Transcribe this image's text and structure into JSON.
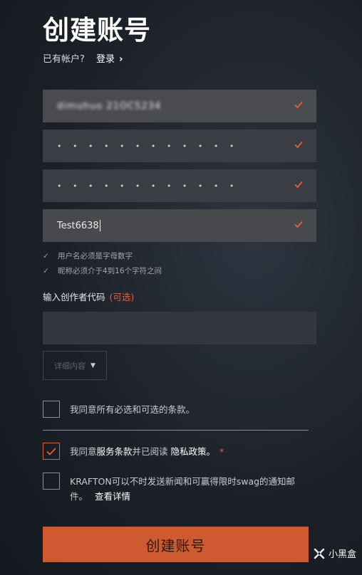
{
  "header": {
    "title": "创建账号",
    "have_account": "已有帐户?",
    "login_link": "登录",
    "login_chevron": "›"
  },
  "form": {
    "email_value": "dimuhuo 21OC5234",
    "password_dots": "• • • • • • • • • • • •",
    "confirm_dots": "• • • • • • • • • • • •",
    "username_value": "Test6638",
    "hints": [
      "用户名必须是字母数字",
      "昵称必须介于4到16个字符之间"
    ],
    "creator_code_label": "输入创作者代码",
    "creator_code_optional": "(可选)",
    "details_button": "详细内容",
    "check_color": "#e0643a"
  },
  "consents": {
    "agree_all": "我同意所有必选和可选的条款。",
    "terms_prefix": "我同意",
    "terms_service": "服务条款",
    "terms_middle": "并已阅读",
    "terms_privacy": "隐私政策。",
    "terms_required": "*",
    "news_line1": "KRAFTON可以不时发送新闻和可赢得限时swag的通知邮",
    "news_line2": "件。",
    "news_details_link": "查看详情"
  },
  "submit": {
    "label": "创建账号",
    "color": "#cf5a30"
  },
  "watermark": {
    "text": "小黑盒"
  }
}
